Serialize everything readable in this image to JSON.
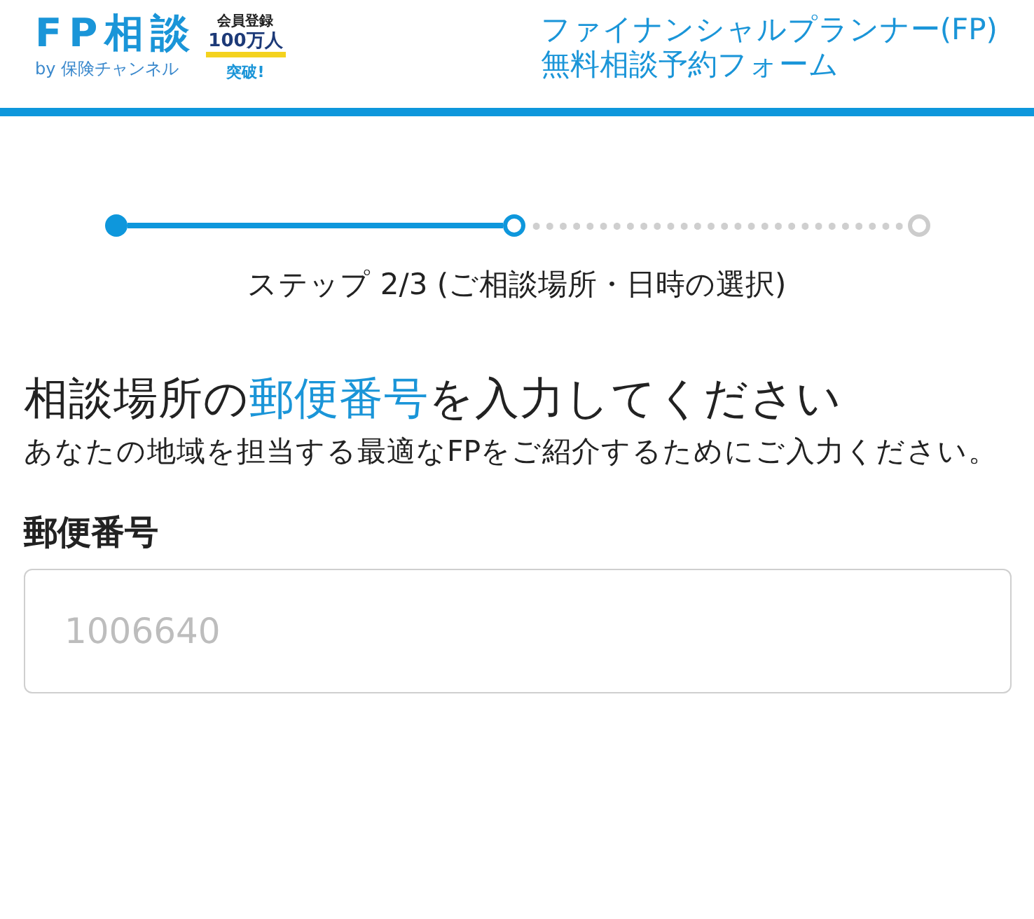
{
  "header": {
    "logo": {
      "mark": "FP相談",
      "byline": "by 保険チャンネル",
      "badge": [
        "会員登録",
        "100万人",
        "突破!"
      ]
    },
    "title_lines": [
      "ファイナンシャルプランナー(FP)",
      "無料相談予約フォーム"
    ]
  },
  "stepper": {
    "steps": [
      {
        "kind": "completed"
      },
      {
        "kind": "current"
      },
      {
        "kind": "upcoming"
      }
    ],
    "caption": "ステップ 2/3 (ご相談場所・日時の選択)"
  },
  "heading": [
    {
      "text": "相談場所の",
      "highlight": false
    },
    {
      "text": "郵便番号",
      "highlight": true
    },
    {
      "text": "を入力してください",
      "highlight": false
    }
  ],
  "description": "あなたの地域を担当する最適なFPをご紹介するためにご入力ください。",
  "field": {
    "label": "郵便番号",
    "placeholder": "1006640"
  }
}
